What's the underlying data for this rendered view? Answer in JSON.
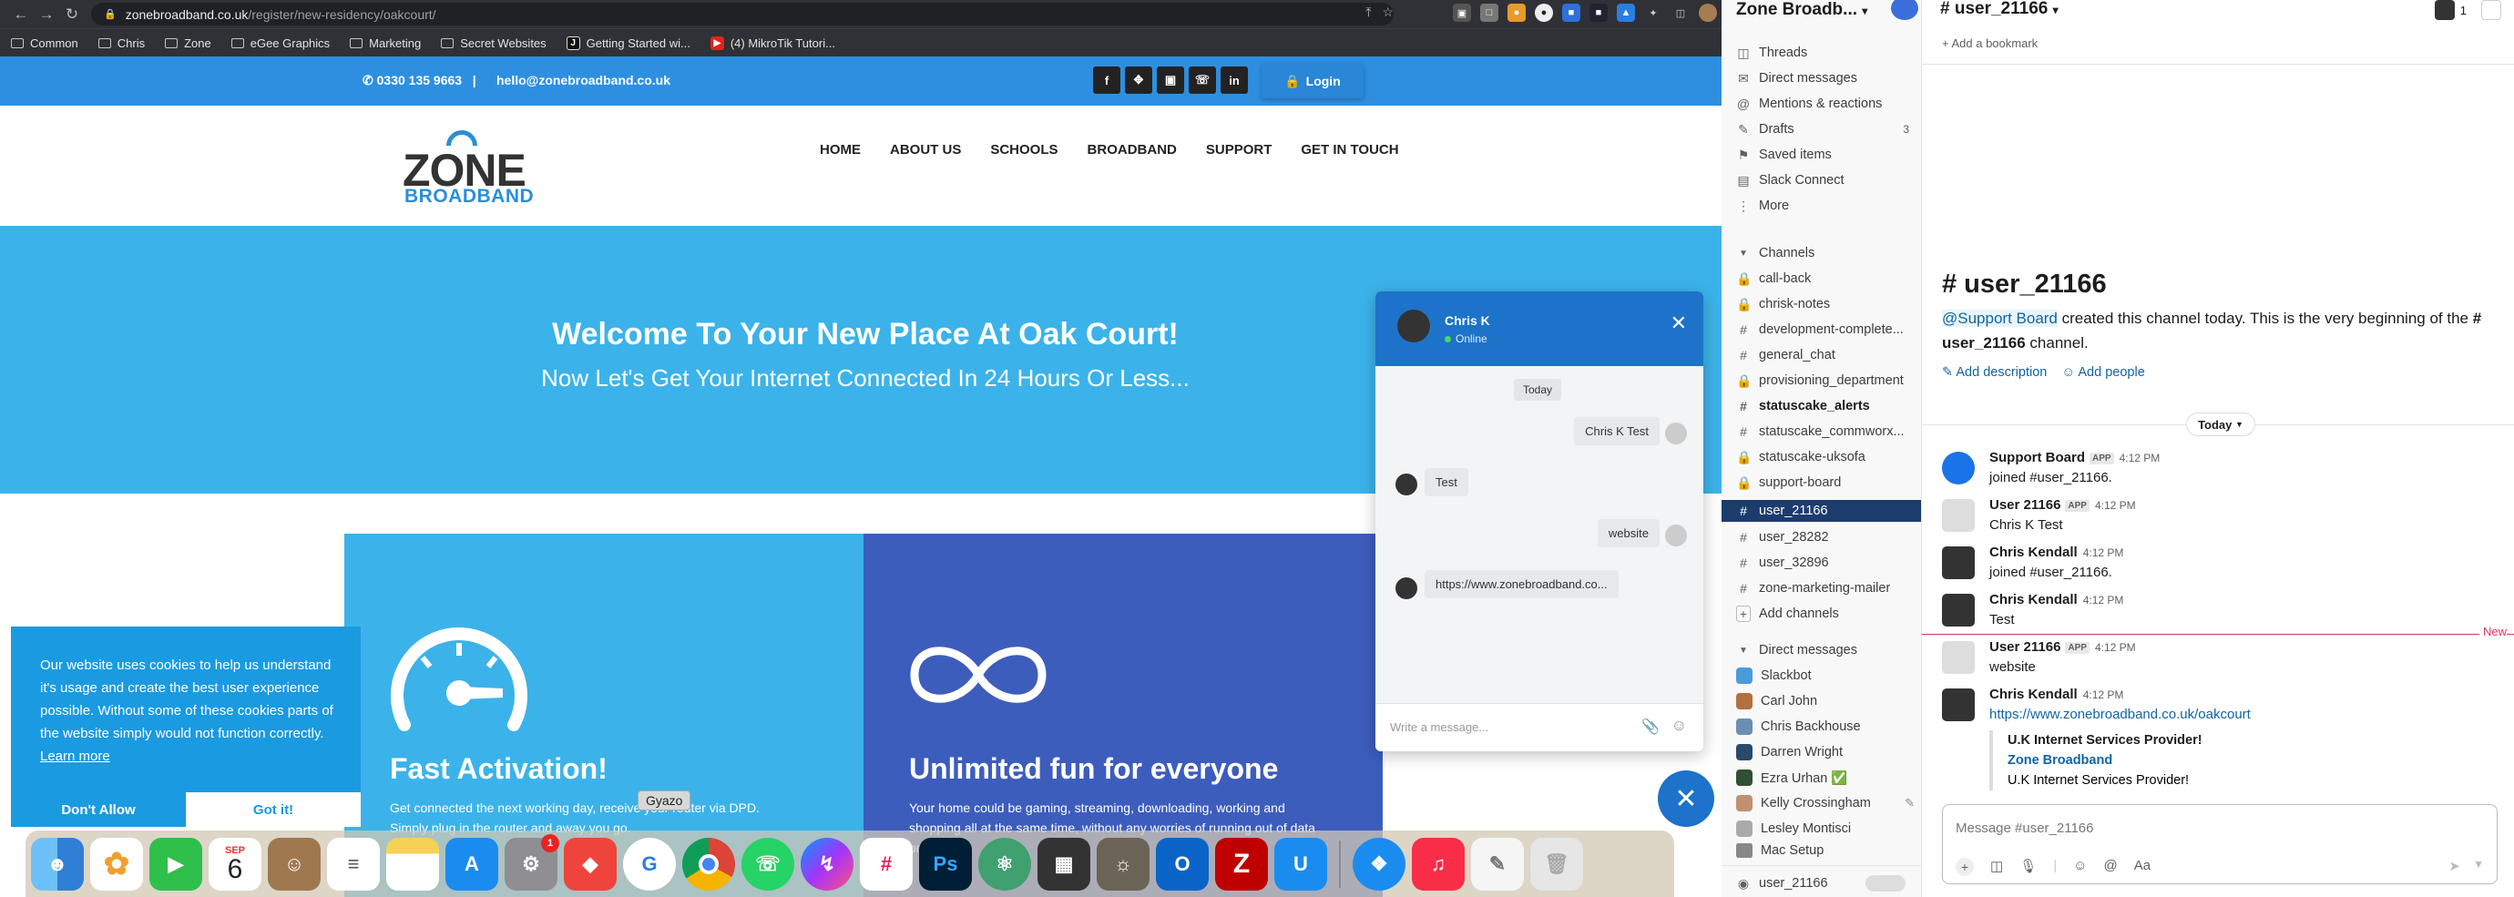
{
  "browser": {
    "url_host": "zonebroadband.co.uk",
    "url_path": "/register/new-residency/oakcourt/",
    "bookmarks": [
      {
        "label": "Common",
        "kind": "folder"
      },
      {
        "label": "Chris",
        "kind": "folder"
      },
      {
        "label": "Zone",
        "kind": "folder"
      },
      {
        "label": "eGee Graphics",
        "kind": "folder"
      },
      {
        "label": "Marketing",
        "kind": "folder"
      },
      {
        "label": "Secret Websites",
        "kind": "folder"
      },
      {
        "label": "Getting Started wi...",
        "kind": "page"
      },
      {
        "label": "(4) MikroTik Tutori...",
        "kind": "youtube"
      }
    ]
  },
  "site": {
    "phone": "0330 135 9663",
    "separator": "|",
    "email": "hello@zonebroadband.co.uk",
    "social": [
      "f",
      "t",
      "ig",
      "wa",
      "in"
    ],
    "login": "Login",
    "logo_top": "ZONE",
    "logo_bottom": "BROADBAND",
    "nav": [
      "HOME",
      "ABOUT US",
      "SCHOOLS",
      "BROADBAND",
      "SUPPORT",
      "GET IN TOUCH"
    ],
    "hero_title": "Welcome To Your New Place At Oak Court!",
    "hero_subtitle": "Now Let's Get Your Internet Connected In 24 Hours Or Less...",
    "feature1_title": "Fast Activation!",
    "feature1_body": "Get connected the next working day, receive your router via DPD. Simply plug in the router and away you go.",
    "feature2_title": "Unlimited fun for everyone",
    "feature2_body": "Your home could be gaming, streaming, downloading, working and shopping all at the same time, without any worries of running out of data or",
    "cookie_text": "Our website uses cookies to help us understand it's usage and create the best user experience possible. Without some of these cookies parts of the website simply would not function correctly.",
    "cookie_link": "Learn more",
    "cookie_deny": "Don't Allow",
    "cookie_accept": "Got it!"
  },
  "chat": {
    "agent": "Chris K",
    "status": "Online",
    "day": "Today",
    "messages": [
      {
        "from": "visitor",
        "text": "Chris K Test"
      },
      {
        "from": "agent",
        "text": "Test"
      },
      {
        "from": "visitor",
        "text": "website"
      },
      {
        "from": "agent",
        "text": "https://www.zonebroadband.co..."
      }
    ],
    "placeholder": "Write a message..."
  },
  "dock": {
    "tooltip": "Gyazo",
    "calendar_month": "SEP",
    "calendar_day": "6",
    "settings_badge": "1",
    "apps": [
      {
        "name": "finder",
        "color": "#3a8ee6"
      },
      {
        "name": "photos",
        "color": "#f0a030"
      },
      {
        "name": "facetime",
        "color": "#2fbf4b"
      },
      {
        "name": "calendar",
        "color": "#ffffff"
      },
      {
        "name": "contacts",
        "color": "#a07850"
      },
      {
        "name": "reminders",
        "color": "#ffffff"
      },
      {
        "name": "notes",
        "color": "#f7d154"
      },
      {
        "name": "app-store",
        "color": "#1a8cf0"
      },
      {
        "name": "system-settings",
        "color": "#8e8e93"
      },
      {
        "name": "anydesk",
        "color": "#ef443b"
      },
      {
        "name": "gyazo",
        "color": "#ffffff"
      },
      {
        "name": "chrome",
        "color": "#ffffff"
      },
      {
        "name": "whatsapp",
        "color": "#25d366"
      },
      {
        "name": "messenger",
        "color": "#a334fa"
      },
      {
        "name": "slack",
        "color": "#ffffff"
      },
      {
        "name": "photoshop",
        "color": "#001e36"
      },
      {
        "name": "atom",
        "color": "#40a070"
      },
      {
        "name": "calculator",
        "color": "#333333"
      },
      {
        "name": "gimp",
        "color": "#6b6356"
      },
      {
        "name": "outlook",
        "color": "#0a64c8"
      },
      {
        "name": "filezilla",
        "color": "#bf0000"
      },
      {
        "name": "unifi",
        "color": "#1a8cf0"
      },
      {
        "name": "safari",
        "color": "#1a8cf0"
      },
      {
        "name": "music",
        "color": "#fa2d48"
      },
      {
        "name": "textedit",
        "color": "#f5f5f5"
      },
      {
        "name": "trash",
        "color": "#d0d0d0"
      }
    ]
  },
  "slack": {
    "workspace": "Zone Broadb...",
    "nav": [
      "Threads",
      "Direct messages",
      "Mentions & reactions",
      "Drafts",
      "Saved items",
      "Slack Connect",
      "More"
    ],
    "drafts_count": "3",
    "channels_header": "Channels",
    "channels": [
      {
        "name": "call-back",
        "lock": true
      },
      {
        "name": "chrisk-notes",
        "lock": true
      },
      {
        "name": "development-complete...",
        "lock": false
      },
      {
        "name": "general_chat",
        "lock": false
      },
      {
        "name": "provisioning_department",
        "lock": true
      },
      {
        "name": "statuscake_alerts",
        "lock": false,
        "bold": true
      },
      {
        "name": "statuscake_commworx...",
        "lock": false
      },
      {
        "name": "statuscake-uksofa",
        "lock": true
      },
      {
        "name": "support-board",
        "lock": true
      },
      {
        "name": "user_21166",
        "lock": false,
        "active": true
      },
      {
        "name": "user_28282",
        "lock": false
      },
      {
        "name": "user_32896",
        "lock": false
      },
      {
        "name": "zone-marketing-mailer",
        "lock": false
      }
    ],
    "add_channels": "Add channels",
    "dms_header": "Direct messages",
    "dms": [
      {
        "name": "Slackbot",
        "color": "#4a9bd9"
      },
      {
        "name": "Carl John",
        "color": "#b07040"
      },
      {
        "name": "Chris Backhouse",
        "color": "#6a8fb0"
      },
      {
        "name": "Darren Wright",
        "color": "#2a4a6a"
      },
      {
        "name": "Ezra Urhan ✅",
        "color": "#305030"
      },
      {
        "name": "Kelly Crossingham",
        "color": "#c09070"
      },
      {
        "name": "Lesley Montisci",
        "color": "#aaaaaa"
      },
      {
        "name": "Mac Setup",
        "color": "#888888"
      }
    ],
    "footer_user": "user_21166",
    "channel_title": "# user_21166",
    "members_count": "1",
    "add_bookmark": "+ Add a bookmark",
    "intro_title": "# user_21166",
    "intro_mention": "@Support Board",
    "intro_text": " created this channel today. This is the very beginning of the ",
    "intro_channel": "# user_21166",
    "intro_end": " channel.",
    "intro_links": [
      "Add description",
      "Add people"
    ],
    "today": "Today",
    "new_label": "New",
    "messages": [
      {
        "name": "Support Board",
        "app": "APP",
        "time": "4:12 PM",
        "text": "joined #user_21166.",
        "avatar": "#1a73e8"
      },
      {
        "name": "User 21166",
        "app": "APP",
        "time": "4:12 PM",
        "text": "Chris K Test",
        "avatar": "#cccccc"
      },
      {
        "name": "Chris Kendall",
        "app": "",
        "time": "4:12 PM",
        "text": "joined #user_21166.",
        "avatar": "#333333"
      },
      {
        "name": "Chris Kendall",
        "app": "",
        "time": "4:12 PM",
        "text": "Test",
        "avatar": "#333333"
      },
      {
        "name": "User 21166",
        "app": "APP",
        "time": "4:12 PM",
        "text": "website",
        "avatar": "#cccccc"
      },
      {
        "name": "Chris Kendall",
        "app": "",
        "time": "4:12 PM",
        "text": "https://www.zonebroadband.co.uk/oakcourt",
        "avatar": "#333333"
      }
    ],
    "unfurl_title": "U.K Internet Services Provider!",
    "unfurl_site": "Zone Broadband",
    "unfurl_desc": "U.K Internet Services Provider!",
    "composer_placeholder": "Message #user_21166"
  }
}
